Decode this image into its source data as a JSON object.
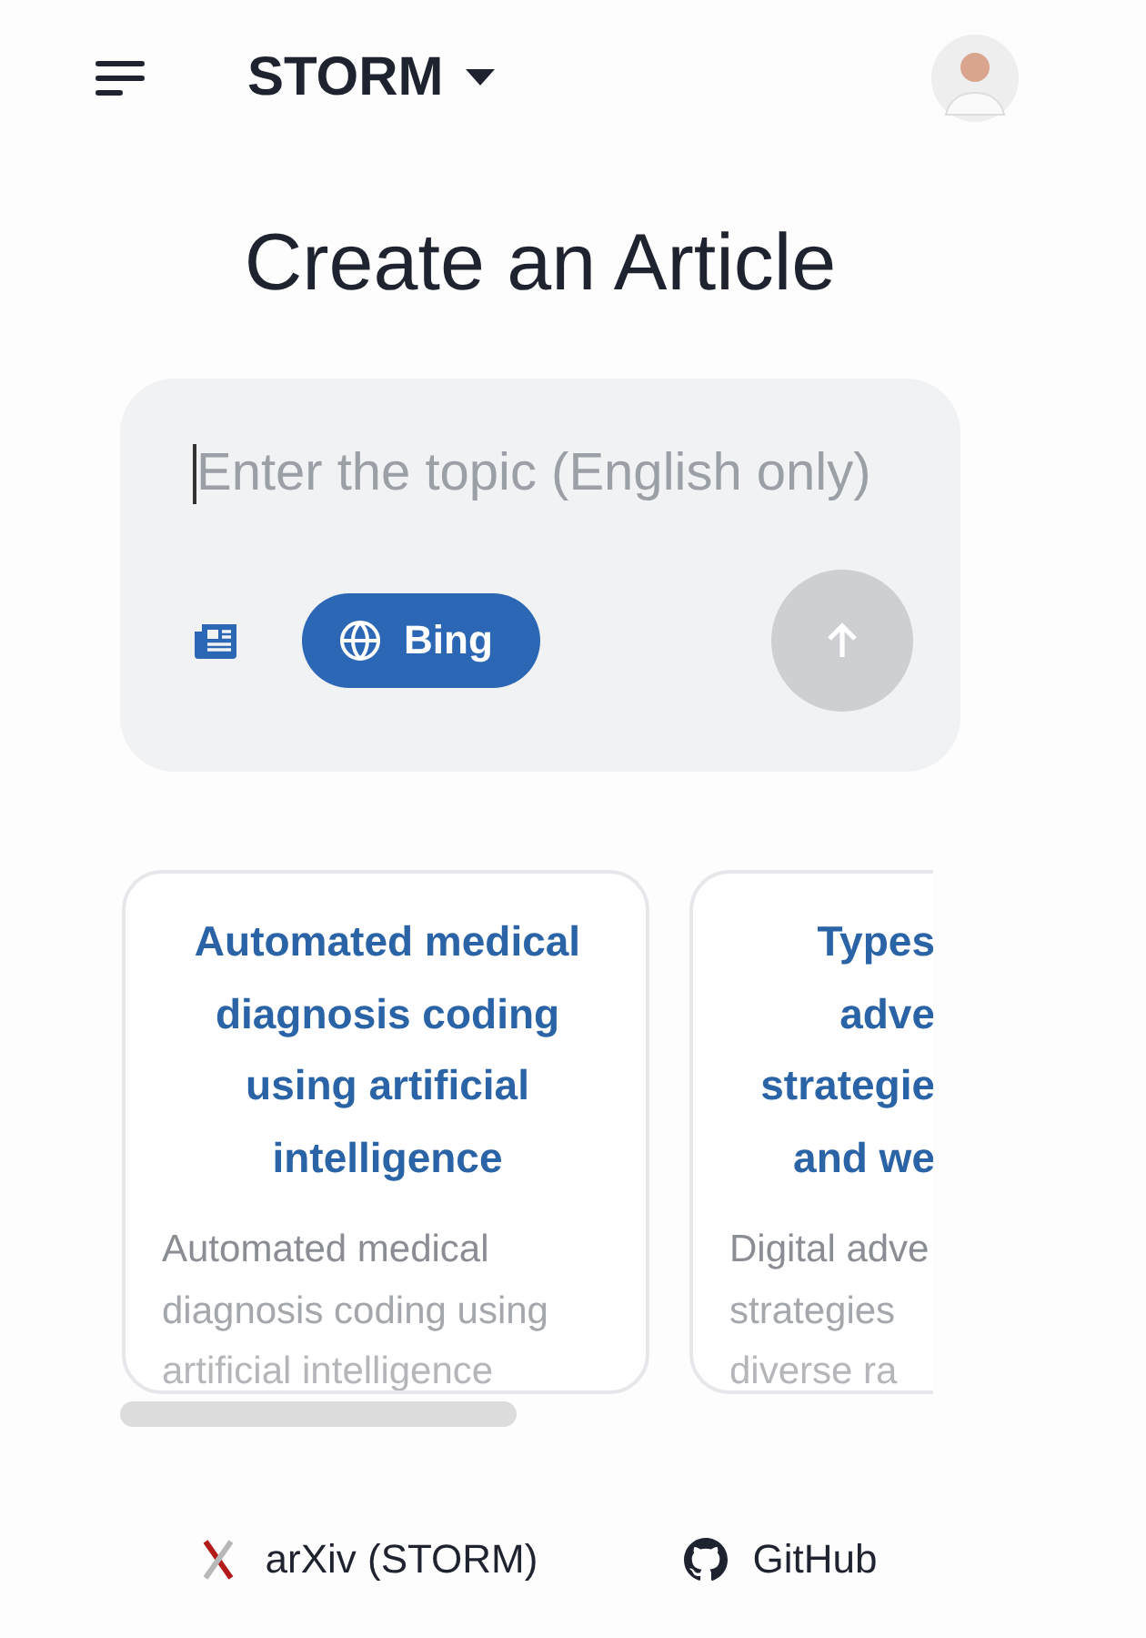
{
  "header": {
    "title": "STORM"
  },
  "heading": "Create an Article",
  "topic_input": {
    "placeholder": "Enter the topic (English only)"
  },
  "search_engine": {
    "label": "Bing",
    "selected": true
  },
  "send_button": {
    "disabled": true
  },
  "cards": [
    {
      "cut": false,
      "title_lines": [
        "Automated medical",
        "diagnosis coding",
        "using artificial",
        "intelligence"
      ],
      "body_lines": [
        "Automated medical",
        "diagnosis coding using",
        "artificial intelligence"
      ]
    },
    {
      "cut": true,
      "title_lines": [
        "Types",
        "adve",
        "strategie",
        "and we"
      ],
      "body_lines": [
        "Digital adve",
        "strategies",
        "diverse ra"
      ]
    }
  ],
  "footer_links": [
    {
      "kind": "arxiv",
      "label": "arXiv (STORM)"
    },
    {
      "kind": "github",
      "label": "GitHub"
    }
  ]
}
